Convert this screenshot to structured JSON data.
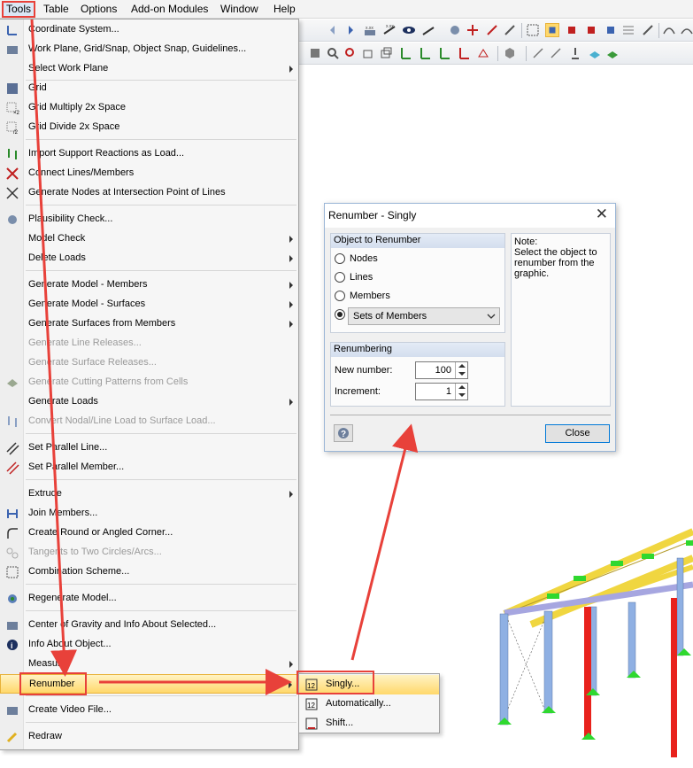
{
  "menubar": {
    "items": [
      "Tools",
      "Table",
      "Options",
      "Add-on Modules",
      "Window",
      "Help"
    ]
  },
  "tools_menu": {
    "items": [
      {
        "label": "Coordinate System...",
        "icon": "coordinate-system-icon",
        "submenu": false,
        "disabled": false
      },
      {
        "label": "Work Plane, Grid/Snap, Object Snap, Guidelines...",
        "icon": "grid-snap-icon",
        "submenu": false,
        "disabled": false
      },
      {
        "label": "Select Work Plane",
        "icon": "",
        "submenu": true,
        "disabled": false
      },
      {
        "label": "Grid",
        "icon": "grid-icon",
        "submenu": false,
        "disabled": false
      },
      {
        "label": "Grid Multiply 2x Space",
        "icon": "grid-multiply-icon",
        "submenu": false,
        "disabled": false
      },
      {
        "label": "Grid Divide 2x Space",
        "icon": "grid-divide-icon",
        "submenu": false,
        "disabled": false
      },
      {
        "label": "Import Support Reactions as Load...",
        "icon": "import-reactions-icon",
        "submenu": false,
        "disabled": false
      },
      {
        "label": "Connect Lines/Members",
        "icon": "connect-lines-icon",
        "submenu": false,
        "disabled": false
      },
      {
        "label": "Generate Nodes at Intersection Point of Lines",
        "icon": "intersection-nodes-icon",
        "submenu": false,
        "disabled": false
      },
      {
        "label": "Plausibility Check...",
        "icon": "plausibility-icon",
        "submenu": false,
        "disabled": false
      },
      {
        "label": "Model Check",
        "icon": "",
        "submenu": true,
        "disabled": false
      },
      {
        "label": "Delete Loads",
        "icon": "",
        "submenu": true,
        "disabled": false
      },
      {
        "label": "Generate Model - Members",
        "icon": "",
        "submenu": true,
        "disabled": false
      },
      {
        "label": "Generate Model - Surfaces",
        "icon": "",
        "submenu": true,
        "disabled": false
      },
      {
        "label": "Generate Surfaces from Members",
        "icon": "",
        "submenu": true,
        "disabled": false
      },
      {
        "label": "Generate Line Releases...",
        "icon": "",
        "submenu": false,
        "disabled": true
      },
      {
        "label": "Generate Surface Releases...",
        "icon": "",
        "submenu": false,
        "disabled": true
      },
      {
        "label": "Generate Cutting Patterns from Cells",
        "icon": "cutting-pattern-icon",
        "submenu": false,
        "disabled": true
      },
      {
        "label": "Generate Loads",
        "icon": "",
        "submenu": true,
        "disabled": false
      },
      {
        "label": "Convert Nodal/Line Load to Surface Load...",
        "icon": "convert-load-icon",
        "submenu": false,
        "disabled": true
      },
      {
        "label": "Set Parallel Line...",
        "icon": "parallel-line-icon",
        "submenu": false,
        "disabled": false
      },
      {
        "label": "Set Parallel Member...",
        "icon": "parallel-member-icon",
        "submenu": false,
        "disabled": false
      },
      {
        "label": "Extrude",
        "icon": "",
        "submenu": true,
        "disabled": false
      },
      {
        "label": "Join Members...",
        "icon": "join-members-icon",
        "submenu": false,
        "disabled": false
      },
      {
        "label": "Create Round or Angled Corner...",
        "icon": "round-corner-icon",
        "submenu": false,
        "disabled": false
      },
      {
        "label": "Tangents to Two Circles/Arcs...",
        "icon": "tangents-icon",
        "submenu": false,
        "disabled": true
      },
      {
        "label": "Combination Scheme...",
        "icon": "combination-scheme-icon",
        "submenu": false,
        "disabled": false
      },
      {
        "label": "Regenerate Model...",
        "icon": "regenerate-icon",
        "submenu": false,
        "disabled": false
      },
      {
        "label": "Center of Gravity and Info About Selected...",
        "icon": "center-gravity-icon",
        "submenu": false,
        "disabled": false
      },
      {
        "label": "Info About Object...",
        "icon": "info-icon",
        "submenu": false,
        "disabled": false
      },
      {
        "label": "Measure",
        "icon": "",
        "submenu": true,
        "disabled": false
      },
      {
        "label": "Renumber",
        "icon": "",
        "submenu": true,
        "disabled": false,
        "highlighted": true
      },
      {
        "label": "Create Video File...",
        "icon": "video-icon",
        "submenu": false,
        "disabled": false
      },
      {
        "label": "Redraw",
        "icon": "redraw-icon",
        "submenu": false,
        "disabled": false
      }
    ]
  },
  "renumber_submenu": {
    "items": [
      {
        "label": "Singly...",
        "icon": "renumber-singly-icon"
      },
      {
        "label": "Automatically...",
        "icon": "renumber-auto-icon"
      },
      {
        "label": "Shift...",
        "icon": "renumber-shift-icon"
      }
    ]
  },
  "dialog": {
    "title": "Renumber - Singly",
    "object_group": {
      "header": "Object to Renumber",
      "options": [
        "Nodes",
        "Lines",
        "Members"
      ],
      "selected_option": "Sets of Members"
    },
    "renumbering_group": {
      "header": "Renumbering",
      "new_number_label": "New number:",
      "new_number_value": "100",
      "increment_label": "Increment:",
      "increment_value": "1"
    },
    "note": {
      "title": "Note:",
      "text": "Select the object to renumber from the graphic."
    },
    "close_label": "Close"
  },
  "colors": {
    "accent_red": "#e8413a",
    "menu_highlight": "#ffd86b",
    "column_blue": "#8fb0e3",
    "column_red": "#e8221c",
    "beam_yellow": "#f0d640",
    "node_green": "#2fd82f"
  }
}
